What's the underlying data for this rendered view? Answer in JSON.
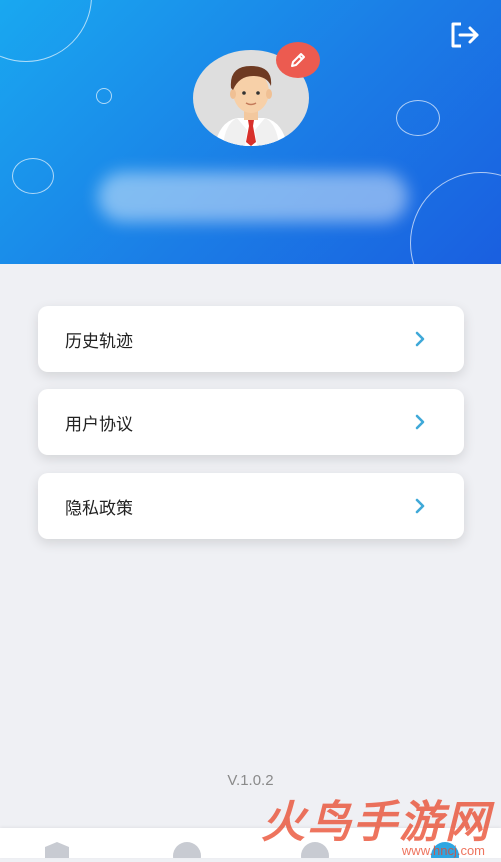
{
  "menu": {
    "items": [
      {
        "label": "历史轨迹"
      },
      {
        "label": "用户协议"
      },
      {
        "label": "隐私政策"
      }
    ]
  },
  "footer": {
    "version": "V.1.0.2"
  },
  "watermark": {
    "text": "火鸟手游网",
    "url": "www.hncj.com"
  },
  "colors": {
    "header_start": "#19a8f0",
    "header_end": "#1a5fe0",
    "edit_badge": "#ec5b50",
    "chevron": "#3fa9d8",
    "background": "#eff0f4"
  },
  "icons": {
    "logout": "logout-icon",
    "edit": "pencil-icon",
    "chevron": "chevron-right-icon"
  }
}
